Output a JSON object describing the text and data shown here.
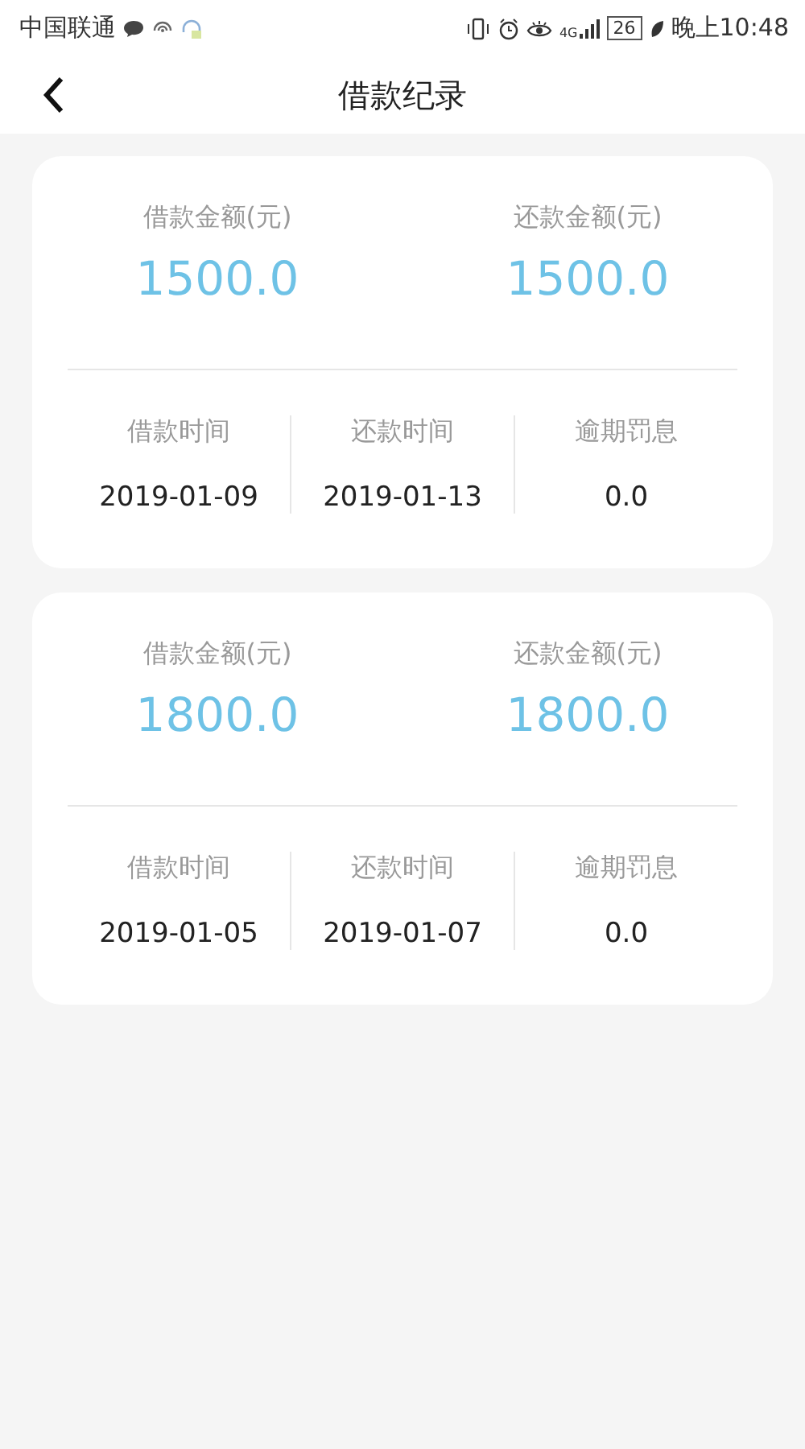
{
  "status_bar": {
    "carrier": "中国联通",
    "network": "4G",
    "battery": "26",
    "time": "晚上10:48"
  },
  "header": {
    "title": "借款纪录"
  },
  "records": [
    {
      "borrow_label": "借款金额(元)",
      "borrow_amount": "1500.0",
      "repay_label": "还款金额(元)",
      "repay_amount": "1500.0",
      "details": [
        {
          "label": "借款时间",
          "value": "2019-01-09"
        },
        {
          "label": "还款时间",
          "value": "2019-01-13"
        },
        {
          "label": "逾期罚息",
          "value": "0.0"
        }
      ]
    },
    {
      "borrow_label": "借款金额(元)",
      "borrow_amount": "1800.0",
      "repay_label": "还款金额(元)",
      "repay_amount": "1800.0",
      "details": [
        {
          "label": "借款时间",
          "value": "2019-01-05"
        },
        {
          "label": "还款时间",
          "value": "2019-01-07"
        },
        {
          "label": "逾期罚息",
          "value": "0.0"
        }
      ]
    }
  ]
}
